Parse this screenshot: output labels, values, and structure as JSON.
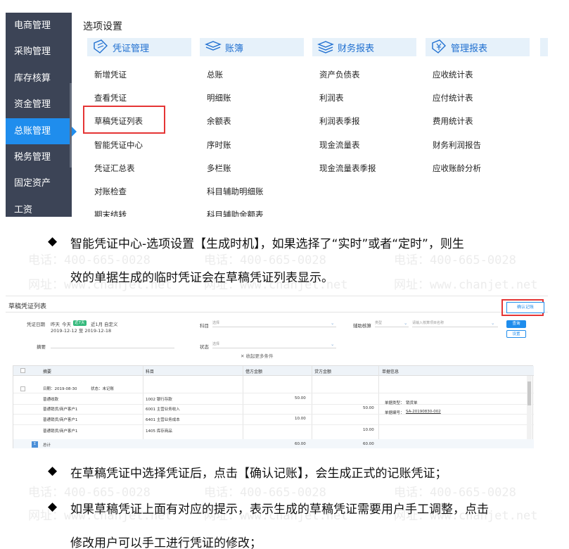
{
  "sidebar": {
    "items": [
      "电商管理",
      "采购管理",
      "库存核算",
      "资金管理",
      "总账管理",
      "税务管理",
      "固定资产",
      "工资"
    ],
    "active_index": 4
  },
  "options_title": "选项设置",
  "columns": [
    {
      "header": "凭证管理",
      "icon": "voucher-icon",
      "items": [
        "新增凭证",
        "查看凭证",
        "草稿凭证列表",
        "智能凭证中心",
        "凭证汇总表",
        "对账检查",
        "期末结转"
      ]
    },
    {
      "header": "账簿",
      "icon": "ledger-icon",
      "items": [
        "总账",
        "明细账",
        "余额表",
        "序时账",
        "多栏账",
        "科目辅助明细账",
        "科目辅助余额表"
      ]
    },
    {
      "header": "财务报表",
      "icon": "report-icon",
      "items": [
        "资产负债表",
        "利润表",
        "利润表季报",
        "现金流量表",
        "现金流量表季报"
      ]
    },
    {
      "header": "管理报表",
      "icon": "yen-report-icon",
      "items": [
        "应收统计表",
        "应付统计表",
        "费用统计表",
        "财务利润报告",
        "应收账龄分析"
      ]
    }
  ],
  "paragraphs": {
    "p1_line1": "智能凭证中心-选项设置【生成时机】，如果选择了“实时”或者“定时”，则生",
    "p1_line2": "效的单据生成的临时凭证会在草稿凭证列表显示。",
    "p2": "在草稿凭证中选择凭证后，点击【确认记账】，会生成正式的记账凭证；",
    "p3_line1": "如果草稿凭证上面有对应的提示，表示生成的草稿凭证需要用户手工调整，点击",
    "p3_line2": "修改用户可以手工进行凭证的修改；"
  },
  "draft": {
    "title": "草稿凭证列表",
    "confirm_button": "确认记账",
    "filter": {
      "date_label": "凭证日期",
      "date_options": [
        "昨天",
        "今天",
        "近7天",
        "近1月",
        "自定义"
      ],
      "active_date": "近7天",
      "date_range": "2019-12-12 至 2019-12-18",
      "subject_label": "科目",
      "subject_placeholder": "选择",
      "aux_label": "辅助核算",
      "aux_placeholder": "类型",
      "aux_value_placeholder": "请输入核算项目名称",
      "summary_label": "摘要",
      "status_label": "状态",
      "status_placeholder": "选择",
      "collapse_label": "收起更多条件",
      "search_button": "查询",
      "reset_button": "设置"
    },
    "table": {
      "headers": [
        "摘要",
        "科目",
        "借方金额",
        "贷方金额",
        "单据信息"
      ],
      "group_date": "日期：2019-08-30",
      "group_status": "状态：未记账",
      "rows": [
        {
          "summary": "普通收款",
          "subject": "1002 银行存款",
          "debit": "50.00",
          "credit": ""
        },
        {
          "summary": "普通销货/商户客户1",
          "subject": "6001 主营业务收入",
          "debit": "",
          "credit": "50.00"
        },
        {
          "summary": "普通销货/商户客户1",
          "subject": "6401 主营业务成本",
          "debit": "10.00",
          "credit": ""
        },
        {
          "summary": "普通销货/商户客户1",
          "subject": "1405 库存商品",
          "debit": "",
          "credit": "10.00"
        }
      ],
      "doc_type_label": "单据类型：",
      "doc_type_value": "销货单",
      "doc_no_label": "单据编号：",
      "doc_no_value": "SA-20190830-002",
      "total_label": "总计",
      "total_debit": "60.00",
      "total_credit": "60.00"
    }
  },
  "watermark": {
    "phone": "电话：400-665-0028",
    "site": "网址：www.chanjet.net"
  }
}
